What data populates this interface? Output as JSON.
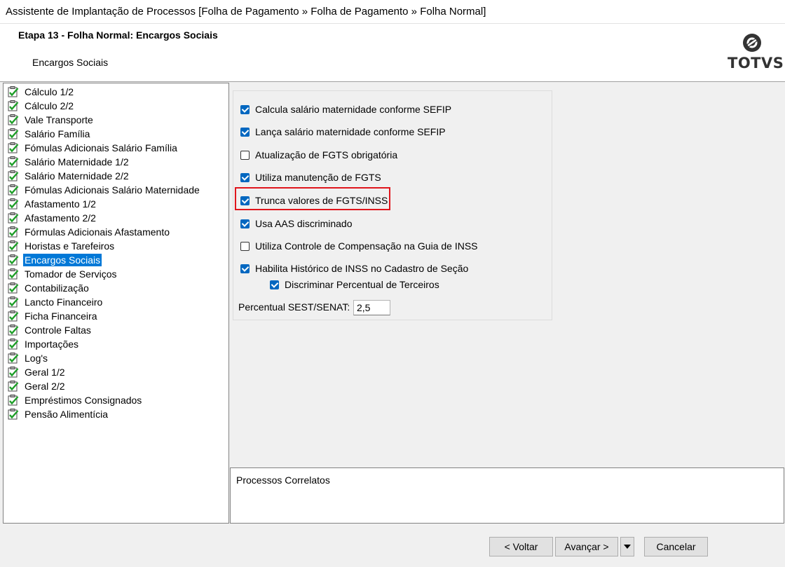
{
  "window": {
    "title": "Assistente de Implantação de Processos [Folha de Pagamento » Folha de Pagamento » Folha Normal]"
  },
  "header": {
    "step_title": "Etapa 13 - Folha Normal: Encargos Sociais",
    "step_subtitle": "Encargos Sociais",
    "logo_text": "TOTVS"
  },
  "tree": {
    "items": [
      {
        "label": "Cálculo 1/2",
        "selected": false
      },
      {
        "label": "Cálculo 2/2",
        "selected": false
      },
      {
        "label": "Vale Transporte",
        "selected": false
      },
      {
        "label": "Salário Família",
        "selected": false
      },
      {
        "label": "Fómulas Adicionais Salário Família",
        "selected": false
      },
      {
        "label": "Salário Maternidade 1/2",
        "selected": false
      },
      {
        "label": "Salário Maternidade 2/2",
        "selected": false
      },
      {
        "label": "Fómulas Adicionais Salário Maternidade",
        "selected": false
      },
      {
        "label": "Afastamento 1/2",
        "selected": false
      },
      {
        "label": "Afastamento 2/2",
        "selected": false
      },
      {
        "label": "Fórmulas Adicionais Afastamento",
        "selected": false
      },
      {
        "label": "Horistas e Tarefeiros",
        "selected": false
      },
      {
        "label": "Encargos Sociais",
        "selected": true
      },
      {
        "label": "Tomador de Serviços",
        "selected": false
      },
      {
        "label": "Contabilização",
        "selected": false
      },
      {
        "label": "Lancto Financeiro",
        "selected": false
      },
      {
        "label": "Ficha Financeira",
        "selected": false
      },
      {
        "label": "Controle Faltas",
        "selected": false
      },
      {
        "label": "Importações",
        "selected": false
      },
      {
        "label": "Log's",
        "selected": false
      },
      {
        "label": "Geral 1/2",
        "selected": false
      },
      {
        "label": "Geral 2/2",
        "selected": false
      },
      {
        "label": "Empréstimos Consignados",
        "selected": false
      },
      {
        "label": "Pensão Alimentícia",
        "selected": false
      }
    ]
  },
  "options": [
    {
      "label": "Calcula salário maternidade conforme SEFIP",
      "checked": true
    },
    {
      "label": "Lança salário maternidade conforme SEFIP",
      "checked": true
    },
    {
      "label": "Atualização de FGTS obrigatória",
      "checked": false
    },
    {
      "label": "Utiliza manutenção de FGTS",
      "checked": true
    },
    {
      "label": "Trunca valores de FGTS/INSS",
      "checked": true,
      "highlighted": true
    },
    {
      "label": "Usa AAS discriminado",
      "checked": true
    },
    {
      "label": "Utiliza Controle de Compensação na Guia de INSS",
      "checked": false
    },
    {
      "label": "Habilita Histórico de INSS no Cadastro de Seção",
      "checked": true
    },
    {
      "label": "Discriminar Percentual de Terceiros",
      "checked": true
    }
  ],
  "sest": {
    "label": "Percentual SEST/SENAT:",
    "value": "2,5"
  },
  "correlatos": {
    "label": "Processos Correlatos"
  },
  "footer": {
    "back_label": "< Voltar",
    "next_label": "Avançar >",
    "cancel_label": "Cancelar"
  },
  "colors": {
    "highlight": "#e0151c",
    "checkbox_accent": "#0067c0",
    "selection": "#0078d7"
  }
}
